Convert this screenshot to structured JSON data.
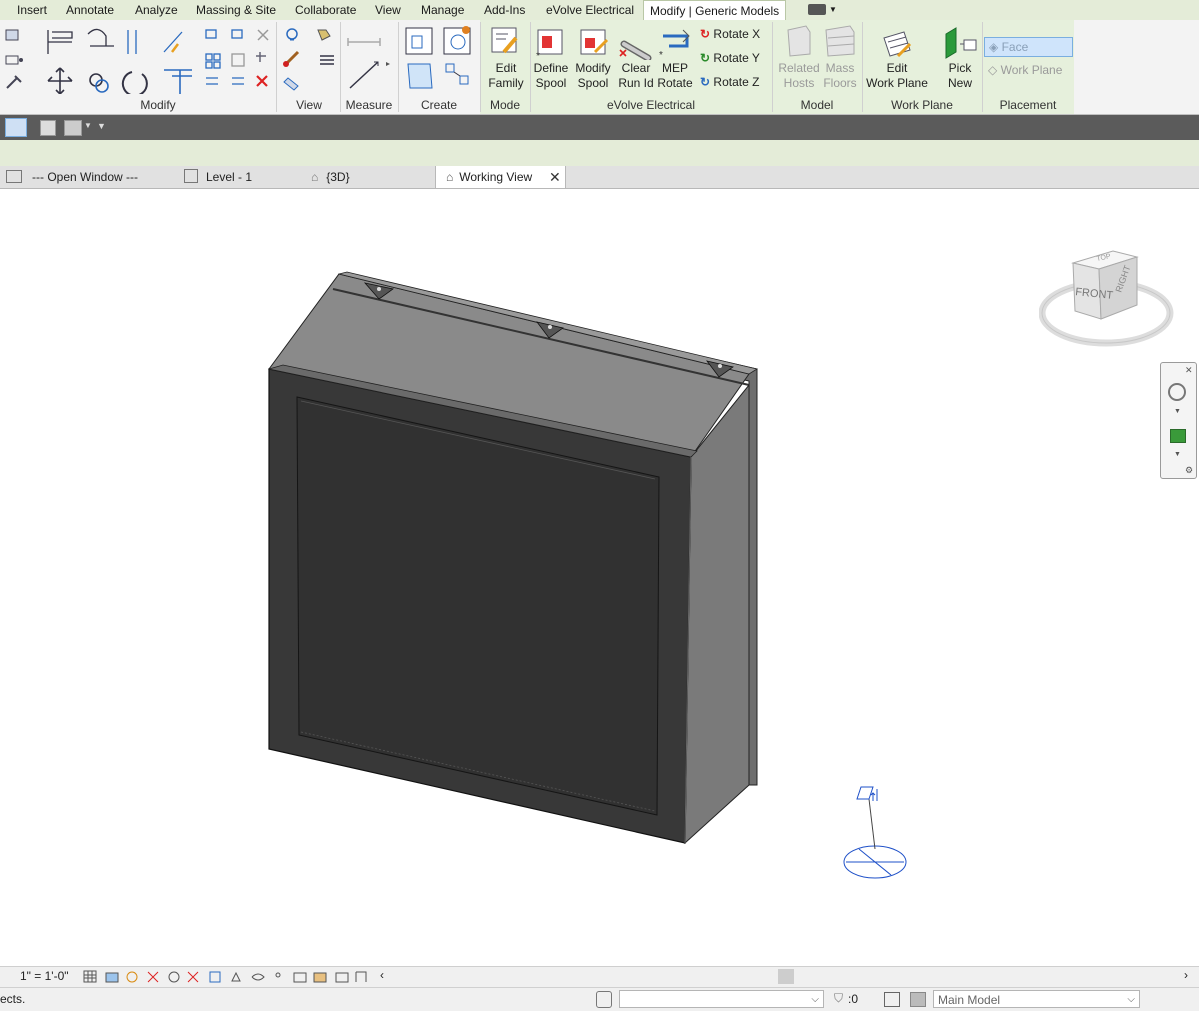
{
  "menu": {
    "tabs": [
      "Insert",
      "Annotate",
      "Analyze",
      "Massing & Site",
      "Collaborate",
      "View",
      "Manage",
      "Add-Ins",
      "eVolve Electrical",
      "Modify | Generic Models"
    ]
  },
  "ribbon": {
    "panels": {
      "modify": "Modify",
      "view": "View",
      "measure": "Measure",
      "create": "Create",
      "mode": "Mode",
      "evolve": "eVolve Electrical",
      "model": "Model",
      "work_plane": "Work Plane",
      "placement": "Placement"
    },
    "buttons": {
      "edit_family": [
        "Edit",
        "Family"
      ],
      "define_spool": [
        "Define",
        "Spool"
      ],
      "modify_spool": [
        "Modify",
        "Spool"
      ],
      "clear_run_id": [
        "Clear",
        "Run Id"
      ],
      "mep_rotate": [
        "MEP",
        "Rotate"
      ],
      "rotate_x": "Rotate X",
      "rotate_y": "Rotate Y",
      "rotate_z": "Rotate Z",
      "related_hosts": [
        "Related",
        "Hosts"
      ],
      "mass_floors": [
        "Mass",
        "Floors"
      ],
      "edit_work_plane": [
        "Edit",
        "Work Plane"
      ],
      "pick_new": [
        "Pick",
        "New"
      ],
      "face": "Face",
      "work_plane_opt": "Work Plane"
    }
  },
  "view_tabs": [
    {
      "label": "---   Open Window   ---"
    },
    {
      "label": "Level - 1"
    },
    {
      "label": "{3D}"
    },
    {
      "label": "Working View"
    }
  ],
  "viewcube": {
    "top": "TOP",
    "front": "FRONT",
    "right": "RIGHT"
  },
  "view_control": {
    "scale": "1\" = 1'-0\""
  },
  "status": {
    "message": "ects.",
    "count": ":0",
    "model": "Main Model"
  },
  "colors": {
    "context_green": "#e6f0dc",
    "box_dark": "#333333",
    "accent_blue": "#1e50c8"
  }
}
